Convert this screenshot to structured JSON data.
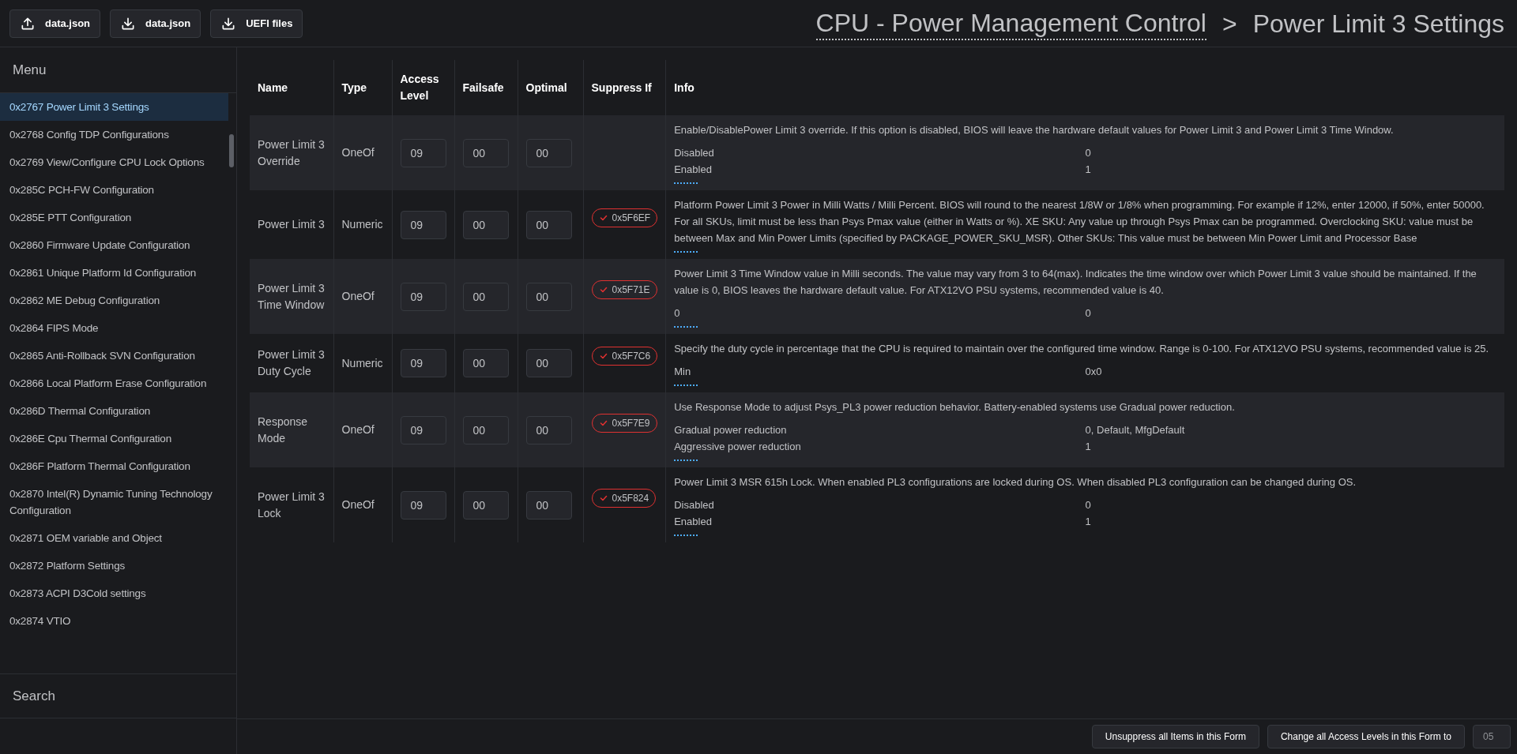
{
  "toolbar": {
    "buttons": [
      {
        "kind": "upload",
        "label": "data.json"
      },
      {
        "kind": "download",
        "label": "data.json"
      },
      {
        "kind": "download",
        "label": "UEFI files"
      }
    ]
  },
  "breadcrumb": {
    "parent": "CPU - Power Management Control",
    "separator": ">",
    "current": "Power Limit 3 Settings"
  },
  "sidebar": {
    "title": "Menu",
    "items": [
      {
        "label": "0x2767 Power Limit 3 Settings",
        "selected": true
      },
      {
        "label": "0x2768 Config TDP Configurations",
        "selected": false
      },
      {
        "label": "0x2769 View/Configure CPU Lock Options",
        "selected": false
      },
      {
        "label": "0x285C PCH-FW Configuration",
        "selected": false
      },
      {
        "label": "0x285E PTT Configuration",
        "selected": false
      },
      {
        "label": "0x2860 Firmware Update Configuration",
        "selected": false
      },
      {
        "label": "0x2861 Unique Platform Id Configuration",
        "selected": false
      },
      {
        "label": "0x2862 ME Debug Configuration",
        "selected": false
      },
      {
        "label": "0x2864 FIPS Mode",
        "selected": false
      },
      {
        "label": "0x2865 Anti-Rollback SVN Configuration",
        "selected": false
      },
      {
        "label": "0x2866 Local Platform Erase Configuration",
        "selected": false
      },
      {
        "label": "0x286D Thermal Configuration",
        "selected": false
      },
      {
        "label": "0x286E Cpu Thermal Configuration",
        "selected": false
      },
      {
        "label": "0x286F Platform Thermal Configuration",
        "selected": false
      },
      {
        "label": "0x2870 Intel(R) Dynamic Tuning Technology Configuration",
        "selected": false
      },
      {
        "label": "0x2871 OEM variable and Object",
        "selected": false
      },
      {
        "label": "0x2872 Platform Settings",
        "selected": false
      },
      {
        "label": "0x2873 ACPI D3Cold settings",
        "selected": false
      },
      {
        "label": "0x2874 VTIO",
        "selected": false
      }
    ],
    "search": "Search"
  },
  "table": {
    "columns": [
      "Name",
      "Type",
      "Access Level",
      "Failsafe",
      "Optimal",
      "Suppress If",
      "Info"
    ],
    "rows": [
      {
        "name": "Power Limit 3 Override",
        "type": "OneOf",
        "access_level": "09",
        "failsafe": "00",
        "optimal": "00",
        "info": "Enable/DisablePower Limit 3 override. If this option is disabled, BIOS will leave the hardware default values for Power Limit 3 and Power Limit 3 Time Window.",
        "options": [
          {
            "label": "Disabled",
            "value": "0"
          },
          {
            "label": "Enabled",
            "value": "1"
          }
        ]
      },
      {
        "name": "Power Limit 3",
        "type": "Numeric",
        "access_level": "09",
        "failsafe": "00",
        "optimal": "00",
        "suppress_if": "0x5F6EF",
        "info": "Platform Power Limit 3 Power in Milli Watts / Milli Percent. BIOS will round to the nearest 1/8W or 1/8% when programming. For example if 12%, enter 12000, if 50%, enter 50000. For all SKUs, limit must be less than Psys Pmax value (either in Watts or %). XE SKU: Any value up through Psys Pmax can be programmed. Overclocking SKU: value must be between Max and Min Power Limits (specified by PACKAGE_POWER_SKU_MSR). Other SKUs: This value must be between Min Power Limit and Processor Base",
        "options": []
      },
      {
        "name": "Power Limit 3 Time Window",
        "type": "OneOf",
        "access_level": "09",
        "failsafe": "00",
        "optimal": "00",
        "suppress_if": "0x5F71E",
        "info": "Power Limit 3 Time Window value in Milli seconds. The value may vary from 3 to 64(max). Indicates the time window over which Power Limit 3 value should be maintained. If the value is 0, BIOS leaves the hardware default value. For ATX12VO PSU systems, recommended value is 40.",
        "options": [
          {
            "label": "0",
            "value": "0"
          }
        ]
      },
      {
        "name": "Power Limit 3 Duty Cycle",
        "type": "Numeric",
        "access_level": "09",
        "failsafe": "00",
        "optimal": "00",
        "suppress_if": "0x5F7C6",
        "info": "Specify the duty cycle in percentage that the CPU is required to maintain over the configured time window. Range is 0-100. For ATX12VO PSU systems, recommended value is 25.",
        "options": [
          {
            "label": "Min",
            "value": "0x0"
          }
        ]
      },
      {
        "name": "Response Mode",
        "type": "OneOf",
        "access_level": "09",
        "failsafe": "00",
        "optimal": "00",
        "suppress_if": "0x5F7E9",
        "info": "Use Response Mode to adjust Psys_PL3 power reduction behavior. Battery-enabled systems use Gradual power reduction.",
        "options": [
          {
            "label": "Gradual power reduction",
            "value": "0, Default, MfgDefault"
          },
          {
            "label": "Aggressive power reduction",
            "value": "1"
          }
        ]
      },
      {
        "name": "Power Limit 3 Lock",
        "type": "OneOf",
        "access_level": "09",
        "failsafe": "00",
        "optimal": "00",
        "suppress_if": "0x5F824",
        "info": "Power Limit 3 MSR 615h Lock. When enabled PL3 configurations are locked during OS. When disabled PL3 configuration can be changed during OS.",
        "options": [
          {
            "label": "Disabled",
            "value": "0"
          },
          {
            "label": "Enabled",
            "value": "1"
          }
        ]
      }
    ]
  },
  "footer": {
    "unsuppress": "Unsuppress all Items in this Form",
    "change_access": "Change all Access Levels in this Form to",
    "access_value": "05"
  }
}
